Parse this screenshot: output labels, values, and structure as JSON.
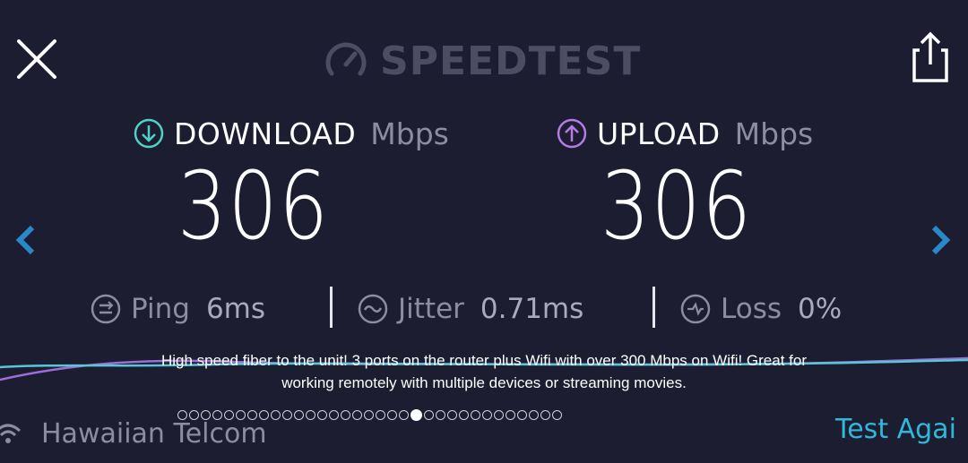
{
  "header": {
    "logo_text": "SPEEDTEST",
    "close_icon": "close-icon",
    "share_icon": "share-icon"
  },
  "download": {
    "label": "DOWNLOAD",
    "unit": "Mbps",
    "value": "306",
    "icon": "download-arrow-icon",
    "accent": "#4fd1c5"
  },
  "upload": {
    "label": "UPLOAD",
    "unit": "Mbps",
    "value": "306",
    "icon": "upload-arrow-icon",
    "accent": "#b57be8"
  },
  "stats": {
    "ping": {
      "label": "Ping",
      "value": "6ms"
    },
    "jitter": {
      "label": "Jitter",
      "value": "0.71ms"
    },
    "loss": {
      "label": "Loss",
      "value": "0%"
    }
  },
  "caption": "High speed fiber to the unit! 3 ports on the router plus Wifi with over 300 Mbps on Wifi! Great for working remotely with multiple devices or streaming movies.",
  "pager": {
    "total": 33,
    "active_index": 20
  },
  "isp": {
    "name": "Hawaiian Telcom",
    "icon": "wifi-icon"
  },
  "actions": {
    "test_again": "Test Agai"
  },
  "colors": {
    "background": "#1d1d31",
    "accent_blue": "#2fb8da",
    "muted": "#8c8da1"
  }
}
